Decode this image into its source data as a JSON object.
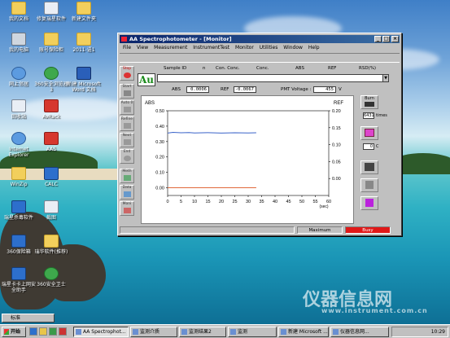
{
  "desktop": {
    "icons": [
      {
        "label": "我的文档"
      },
      {
        "label": "修复瑞星软件"
      },
      {
        "label": "新建文件夹"
      },
      {
        "label": "我的电脑"
      },
      {
        "label": "账号保险柜"
      },
      {
        "label": "2011-语1"
      },
      {
        "label": "网上邻居"
      },
      {
        "label": "360安全浏览器 3"
      },
      {
        "label": "新建 Microsoft Word 文档"
      },
      {
        "label": "回收站"
      },
      {
        "label": "AvRack"
      },
      {
        "label": "Internet Explorer"
      },
      {
        "label": "AAS"
      },
      {
        "label": "WinZip"
      },
      {
        "label": "CALC"
      },
      {
        "label": "瑞星杀毒软件"
      },
      {
        "label": "截图"
      },
      {
        "label": "360保险箱"
      },
      {
        "label": "瑞华软件(推荐)"
      },
      {
        "label": "瑞星卡卡上网安全助手"
      },
      {
        "label": "360安全卫士"
      }
    ],
    "watermark": "仪器信息网",
    "watermark_url": "www.instrument.com.cn"
  },
  "window": {
    "title": "AA Spectrophotometer - [Monitor]",
    "menu": [
      "File",
      "View",
      "Measurement",
      "InstrumentTest",
      "Monitor",
      "Utilities",
      "Window",
      "Help"
    ],
    "header": {
      "sample_id": "Sample ID",
      "n": "n",
      "con_conc": "Con. Conc.",
      "conc": "Conc.",
      "abs": "ABS",
      "ref": "REF",
      "rsd": "RSD(%)"
    },
    "au_label": "Au",
    "readout": {
      "abs_label": "ABS",
      "abs_value": "0.0006",
      "ref_label": "REF",
      "ref_value": "-0.0067",
      "pmt_label": "PMT Voltage :",
      "pmt_value": "455",
      "pmt_unit": "V"
    },
    "left_buttons": [
      "Stop",
      "Start",
      "Auto 0",
      "Refine",
      "Next",
      "End",
      "Meth",
      "Data",
      "Moni"
    ],
    "right_panel": {
      "burn_label": "Burn",
      "times_value": "6431",
      "times_unit": "times",
      "temp_value": "0",
      "temp_unit": "C"
    },
    "status": {
      "maximum": "Maximum",
      "busy": "Busy"
    }
  },
  "chart_data": {
    "type": "line",
    "xlabel": "(sec)",
    "left_axis_title": "ABS",
    "right_axis_title": "REF",
    "xlim": [
      0,
      60
    ],
    "xticks": [
      0,
      5,
      10,
      15,
      20,
      25,
      30,
      35,
      40,
      45,
      50,
      55,
      60
    ],
    "ylim_left": [
      -0.05,
      0.5
    ],
    "yticks_left": [
      0.0,
      0.1,
      0.2,
      0.3,
      0.4,
      0.5
    ],
    "ylim_right": [
      -0.05,
      0.2
    ],
    "yticks_right": [
      0.0,
      0.05,
      0.1,
      0.15,
      0.2
    ],
    "series": [
      {
        "color": "#3a63c9",
        "x": [
          0,
          2,
          5,
          8,
          10,
          15,
          20,
          25,
          30,
          33
        ],
        "y": [
          0.355,
          0.36,
          0.357,
          0.359,
          0.356,
          0.358,
          0.355,
          0.357,
          0.356,
          0.357
        ]
      },
      {
        "color": "#e0683a",
        "x": [
          0,
          33
        ],
        "y": [
          0.0,
          0.0
        ]
      }
    ],
    "grid": false
  },
  "taskbar": {
    "start_label": "开始",
    "tasks": [
      "AA Spectrophot...",
      "监测介质",
      "监测结果2",
      "监测",
      "新建 Microsoft ...",
      "仪器信息网..."
    ],
    "language_bar": "标准",
    "clock": "10:29"
  }
}
